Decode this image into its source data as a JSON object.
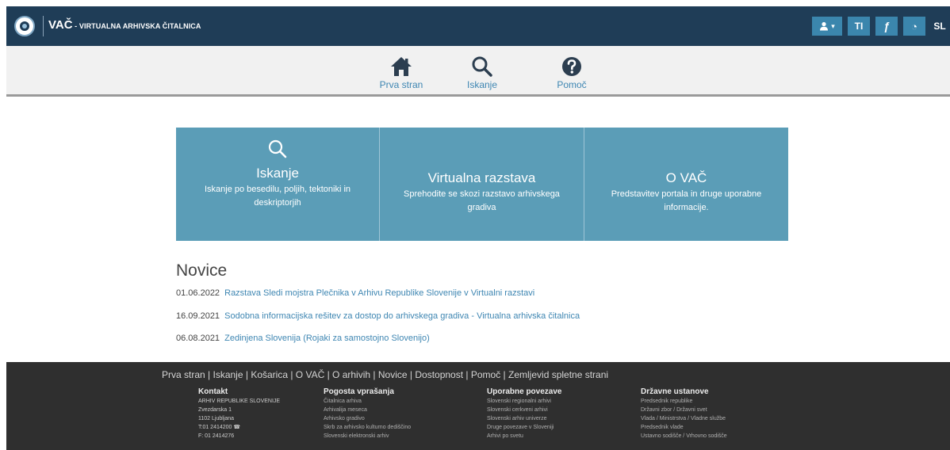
{
  "header": {
    "brand_main": "VAČ",
    "brand_dash": " - ",
    "brand_sub": "VIRTUALNA ARHIVSKA ČITALNICA",
    "toolbar": {
      "user_label": "▾",
      "text_size_label": "TI",
      "font_label": "ƒ",
      "contrast_label": "◔",
      "language_label": "SL"
    }
  },
  "nav": {
    "home_label": "Prva stran",
    "search_label": "Iskanje",
    "help_label": "Pomoč"
  },
  "tiles": [
    {
      "title": "Iskanje",
      "desc": "Iskanje po besedilu, poljih, tektoniki in deskriptorjih"
    },
    {
      "title": "Virtualna razstava",
      "desc": "Sprehodite se skozi razstavo arhivskega gradiva"
    },
    {
      "title": "O VAČ",
      "desc": "Predstavitev portala in druge uporabne informacije."
    }
  ],
  "news": {
    "heading": "Novice",
    "items": [
      {
        "date": "01.06.2022",
        "title": "Razstava Sledi mojstra Plečnika v Arhivu Republike Slovenije v Virtualni razstavi"
      },
      {
        "date": "16.09.2021",
        "title": "Sodobna informacijska rešitev za dostop do arhivskega gradiva - Virtualna arhivska čitalnica"
      },
      {
        "date": "06.08.2021",
        "title": "Zedinjena Slovenija (Rojaki za samostojno Slovenijo)"
      }
    ]
  },
  "footer": {
    "links": [
      "Prva stran",
      "Iskanje",
      "Košarica",
      "O VAČ",
      "O arhivih",
      "Novice",
      "Dostopnost",
      "Pomoč",
      "Zemljevid spletne strani"
    ],
    "link_separator": " | ",
    "contact": {
      "heading": "Kontakt",
      "lines": [
        "ARHIV REPUBLIKE SLOVENIJE",
        "Zvezdarska 1",
        "1102 Ljubljana",
        "T:01 2414200 ☎",
        "F: 01 2414276"
      ]
    },
    "faq": {
      "heading": "Pogosta vprašanja",
      "lines": [
        "Čitalnica arhiva",
        "Arhivalija meseca",
        "Arhivsko gradivo",
        "Skrb za arhivsko kulturno dediščino",
        "Slovenski elektronski arhiv"
      ]
    },
    "useful": {
      "heading": "Uporabne povezave",
      "lines": [
        "Slovenski regionalni arhivi",
        "Slovenski cerkveni arhivi",
        "Slovenski arhiv univerze",
        "Druge povezave v Sloveniji",
        "Arhivi po svetu"
      ]
    },
    "institutions": {
      "heading": "Državne ustanove",
      "lines": [
        "Predsednik republike",
        "Državni zbor / Državni svet",
        "Vlada / Ministrstva / Vladne službe",
        "Predsednik vlade",
        "Ustavno sodišče / Vrhovno sodišče"
      ]
    }
  },
  "colors": {
    "header_bg": "#1f3d57",
    "toolbar_button": "#3b86ad",
    "tile_bg": "#5b9db7",
    "link": "#3e86b2",
    "footer_bg": "#2f2f2f"
  }
}
